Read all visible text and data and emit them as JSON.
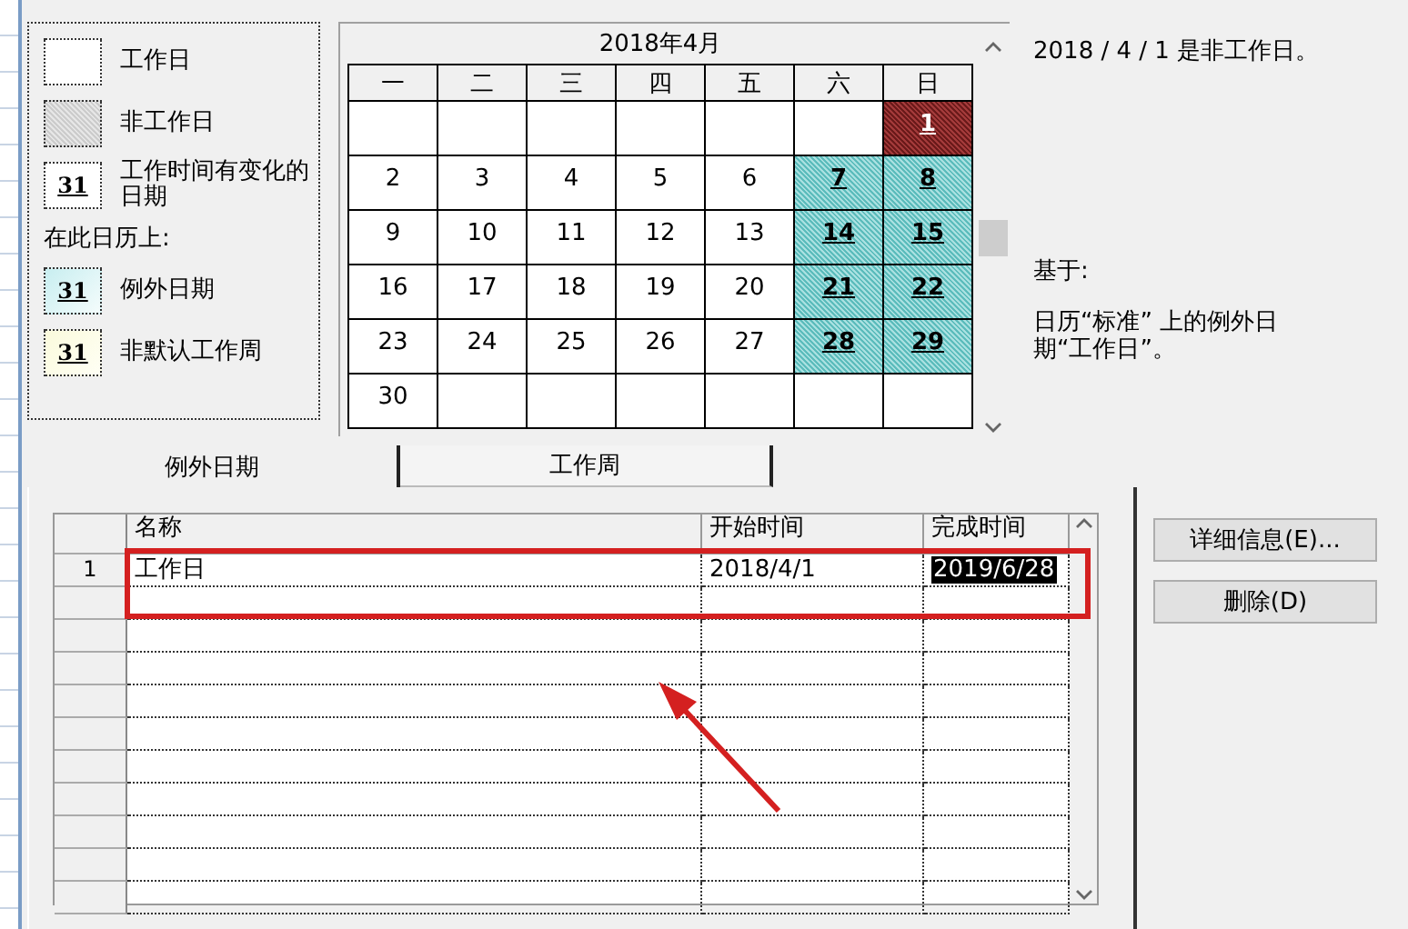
{
  "legend": {
    "items": [
      {
        "kind": "working",
        "label": "工作日"
      },
      {
        "kind": "nonworking",
        "label": "非工作日"
      },
      {
        "kind": "changed",
        "swatch": "31",
        "label": "工作时间有变化的日期"
      },
      {
        "kind": "heading",
        "label": "在此日历上:"
      },
      {
        "kind": "exception",
        "swatch": "31",
        "label": "例外日期"
      },
      {
        "kind": "nondefault",
        "swatch": "31",
        "label": "非默认工作周"
      }
    ]
  },
  "calendar": {
    "month": "2018年4月",
    "weekdays": [
      "一",
      "二",
      "三",
      "四",
      "五",
      "六",
      "日"
    ],
    "weeks": [
      [
        {
          "kind": "blank"
        },
        {
          "kind": "blank"
        },
        {
          "kind": "blank"
        },
        {
          "kind": "blank"
        },
        {
          "kind": "blank"
        },
        {
          "kind": "blank"
        },
        {
          "kind": "exception",
          "day": "1",
          "selected": true
        }
      ],
      [
        {
          "kind": "working",
          "day": "2",
          "selected": false
        },
        {
          "kind": "working",
          "day": "3",
          "selected": false
        },
        {
          "kind": "working",
          "day": "4",
          "selected": false
        },
        {
          "kind": "working",
          "day": "5",
          "selected": false
        },
        {
          "kind": "working",
          "day": "6",
          "selected": false
        },
        {
          "kind": "exception",
          "day": "7",
          "selected": false
        },
        {
          "kind": "exception",
          "day": "8",
          "selected": false
        }
      ],
      [
        {
          "kind": "working",
          "day": "9",
          "selected": false
        },
        {
          "kind": "working",
          "day": "10",
          "selected": false
        },
        {
          "kind": "working",
          "day": "11",
          "selected": false
        },
        {
          "kind": "working",
          "day": "12",
          "selected": false
        },
        {
          "kind": "working",
          "day": "13",
          "selected": false
        },
        {
          "kind": "exception",
          "day": "14",
          "selected": false
        },
        {
          "kind": "exception",
          "day": "15",
          "selected": false
        }
      ],
      [
        {
          "kind": "working",
          "day": "16",
          "selected": false
        },
        {
          "kind": "working",
          "day": "17",
          "selected": false
        },
        {
          "kind": "working",
          "day": "18",
          "selected": false
        },
        {
          "kind": "working",
          "day": "19",
          "selected": false
        },
        {
          "kind": "working",
          "day": "20",
          "selected": false
        },
        {
          "kind": "exception",
          "day": "21",
          "selected": false
        },
        {
          "kind": "exception",
          "day": "22",
          "selected": false
        }
      ],
      [
        {
          "kind": "working",
          "day": "23",
          "selected": false
        },
        {
          "kind": "working",
          "day": "24",
          "selected": false
        },
        {
          "kind": "working",
          "day": "25",
          "selected": false
        },
        {
          "kind": "working",
          "day": "26",
          "selected": false
        },
        {
          "kind": "working",
          "day": "27",
          "selected": false
        },
        {
          "kind": "exception",
          "day": "28",
          "selected": false
        },
        {
          "kind": "exception",
          "day": "29",
          "selected": false
        }
      ],
      [
        {
          "kind": "working",
          "day": "30",
          "selected": false
        },
        {
          "kind": "blank"
        },
        {
          "kind": "blank"
        },
        {
          "kind": "blank"
        },
        {
          "kind": "blank"
        },
        {
          "kind": "blank"
        },
        {
          "kind": "blank"
        }
      ]
    ]
  },
  "info": {
    "status": "2018 / 4 / 1 是非工作日。",
    "based_on_label": "基于:",
    "based_on_text": "日历“标准” 上的例外日期“工作日”。"
  },
  "tabs": [
    {
      "label": "例外日期",
      "selected": true
    },
    {
      "label": "工作周",
      "selected": false
    }
  ],
  "table": {
    "columns": [
      "名称",
      "开始时间",
      "完成时间"
    ],
    "rows": [
      {
        "number": "1",
        "name": "工作日",
        "start": "2018/4/1",
        "finish": "2019/6/28",
        "finish_selected": true
      }
    ]
  },
  "buttons": [
    "详细信息(E)...",
    "删除(D)"
  ]
}
